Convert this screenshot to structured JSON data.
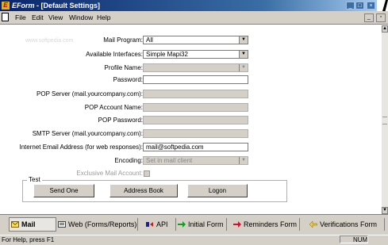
{
  "window": {
    "title_app": "EForm",
    "title_doc": " - [Default Settings]",
    "logo_letter": "E",
    "titlebar_buttons": [
      "_",
      "□",
      "×"
    ]
  },
  "menu": {
    "items": [
      "File",
      "Edit",
      "View",
      "Window",
      "Help"
    ],
    "mdi_buttons": [
      "_",
      "▫"
    ]
  },
  "watermark": "www.softpedia.com",
  "form": {
    "mail_program": {
      "label": "Mail Program:",
      "value": "All"
    },
    "available_interfaces": {
      "label": "Available Interfaces:",
      "value": "Simple Mapi32"
    },
    "profile_name": {
      "label": "Profile Name:",
      "value": ""
    },
    "password": {
      "label": "Password:",
      "value": ""
    },
    "pop_server": {
      "label": "POP Server (mail.yourcompany.com):",
      "value": ""
    },
    "pop_account": {
      "label": "POP Account Name:",
      "value": ""
    },
    "pop_password": {
      "label": "POP Password:",
      "value": ""
    },
    "smtp_server": {
      "label": "SMTP Server (mail.yourcompany.com):",
      "value": ""
    },
    "internet_email": {
      "label": "Internet Email Address (for web responses):",
      "value": "mail@softpedia.com"
    },
    "encoding": {
      "label": "Encoding:",
      "value": "Set in mail client"
    },
    "exclusive": {
      "label": "Exclusive Mail Account:"
    }
  },
  "test": {
    "legend": "Test",
    "send_one": "Send One",
    "address_book": "Address Book",
    "logon": "Logon"
  },
  "tabs": [
    {
      "label": "Mail",
      "icon": "mail-icon"
    },
    {
      "label": "Web (Forms/Reports)",
      "icon": "web-icon"
    },
    {
      "label": "API",
      "icon": "api-icon"
    },
    {
      "label": "Initial Form",
      "icon": "green-arrow-icon"
    },
    {
      "label": "Reminders Form",
      "icon": "red-arrow-icon"
    },
    {
      "label": "Verifications Form",
      "icon": "yellow-arrow-icon"
    }
  ],
  "status": {
    "help_text": "For Help, press F1",
    "num": "NUM"
  },
  "colors": {
    "titlebar": "#0a246a",
    "face": "#d4d0c8"
  }
}
